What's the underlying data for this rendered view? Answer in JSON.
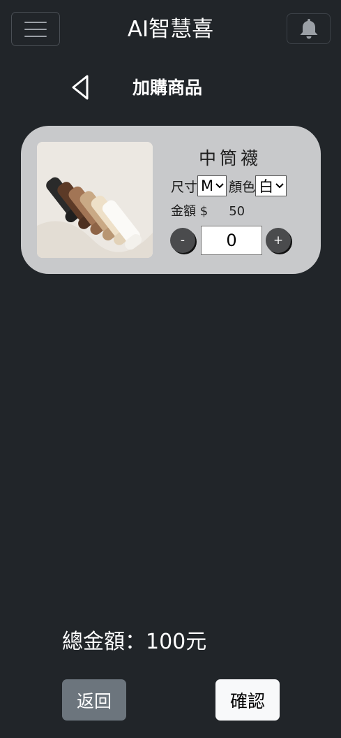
{
  "header": {
    "title": "AI智慧喜",
    "menu_icon": "hamburger-menu-icon",
    "bell_icon": "bell-icon"
  },
  "subheader": {
    "back_icon": "back-arrow-icon",
    "title": "加購商品"
  },
  "product": {
    "name": "中筒襪",
    "size_label": "尺寸",
    "size_value": "M",
    "color_label": "顏色",
    "color_value": "白",
    "price_label": "金額 $",
    "price_value": "50",
    "minus_label": "-",
    "plus_label": "+",
    "quantity": "0"
  },
  "footer": {
    "total_text": "總金額：100元",
    "return_label": "返回",
    "confirm_label": "確認"
  },
  "colors": {
    "background": "#212529",
    "card": "#c8c9cb",
    "return_button": "#6c757d",
    "confirm_button": "#f8f9fa"
  }
}
